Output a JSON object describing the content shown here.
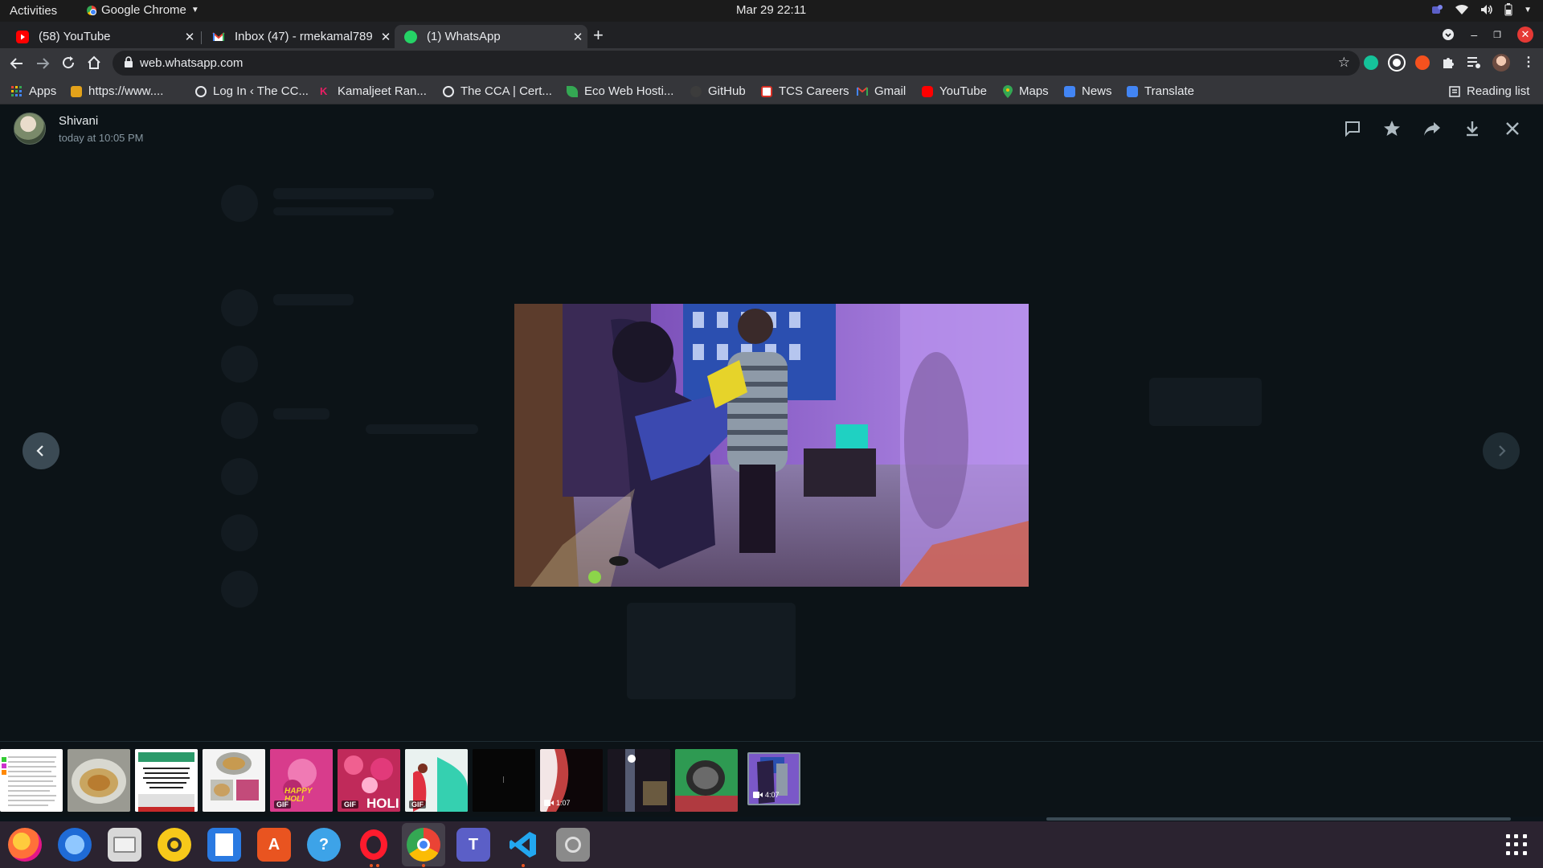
{
  "system": {
    "activities": "Activities",
    "app_name": "Google Chrome",
    "clock": "Mar 29  22:11"
  },
  "tabs": [
    {
      "title": "(58) YouTube",
      "favicon": "youtube-icon",
      "color": "#ff0000"
    },
    {
      "title": "Inbox (47) - rmekamal789",
      "favicon": "gmail-icon",
      "color": "#ea4335"
    },
    {
      "title": "(1) WhatsApp",
      "favicon": "whatsapp-icon",
      "color": "#25d366",
      "active": true
    }
  ],
  "omnibox": {
    "url": "web.whatsapp.com"
  },
  "bookmarks": [
    {
      "label": "Apps",
      "icon": "apps-grid-icon",
      "color": "#f4b400"
    },
    {
      "label": "https://www....",
      "icon": "package-icon",
      "color": "#e3a21a"
    },
    {
      "label": "Log In ‹ The CC...",
      "icon": "globe-icon",
      "color": "#e8eaed"
    },
    {
      "label": "Kamaljeet Ran...",
      "icon": "k-logo-icon",
      "color": "#e91e63"
    },
    {
      "label": "The CCA | Cert...",
      "icon": "globe-icon",
      "color": "#e8eaed"
    },
    {
      "label": "Eco Web Hosti...",
      "icon": "leaf-icon",
      "color": "#34a853"
    },
    {
      "label": "GitHub",
      "icon": "github-icon",
      "color": "#3c3c3c"
    },
    {
      "label": "TCS Careers",
      "icon": "tcs-icon",
      "color": "#d93025"
    },
    {
      "label": "Gmail",
      "icon": "gmail-icon",
      "color": "#ea4335"
    },
    {
      "label": "YouTube",
      "icon": "youtube-icon",
      "color": "#ff0000"
    },
    {
      "label": "Maps",
      "icon": "maps-pin-icon",
      "color": "#34a853"
    },
    {
      "label": "News",
      "icon": "news-icon",
      "color": "#4285f4"
    },
    {
      "label": "Translate",
      "icon": "translate-icon",
      "color": "#4285f4"
    },
    {
      "label": "Reading list",
      "icon": "reading-list-icon",
      "color": "#e8eaed"
    }
  ],
  "viewer": {
    "sender_name": "Shivani",
    "timestamp": "today at 10:05 PM",
    "header_actions": [
      "reply-icon",
      "star-icon",
      "forward-icon",
      "download-icon",
      "close-icon"
    ]
  },
  "thumbnails": [
    {
      "kind": "document",
      "badge": ""
    },
    {
      "kind": "photo-pot",
      "badge": ""
    },
    {
      "kind": "poster",
      "badge": ""
    },
    {
      "kind": "photo-pot-collage",
      "badge": ""
    },
    {
      "kind": "gif-happy",
      "badge": "GIF",
      "caption": "HAPPY HOLI"
    },
    {
      "kind": "gif-holi",
      "badge": "GIF",
      "caption": "HOLI"
    },
    {
      "kind": "gif-colors",
      "badge": "GIF"
    },
    {
      "kind": "video-dark",
      "badge": ""
    },
    {
      "kind": "video",
      "duration": "1:07"
    },
    {
      "kind": "video-night",
      "badge": ""
    },
    {
      "kind": "photo-green",
      "badge": ""
    },
    {
      "kind": "video-selected",
      "duration": "4:07"
    }
  ],
  "colors": {
    "viewer_bg": "#0c1317",
    "icon_gray": "#aebac1",
    "whatsapp_green": "#25d366"
  }
}
